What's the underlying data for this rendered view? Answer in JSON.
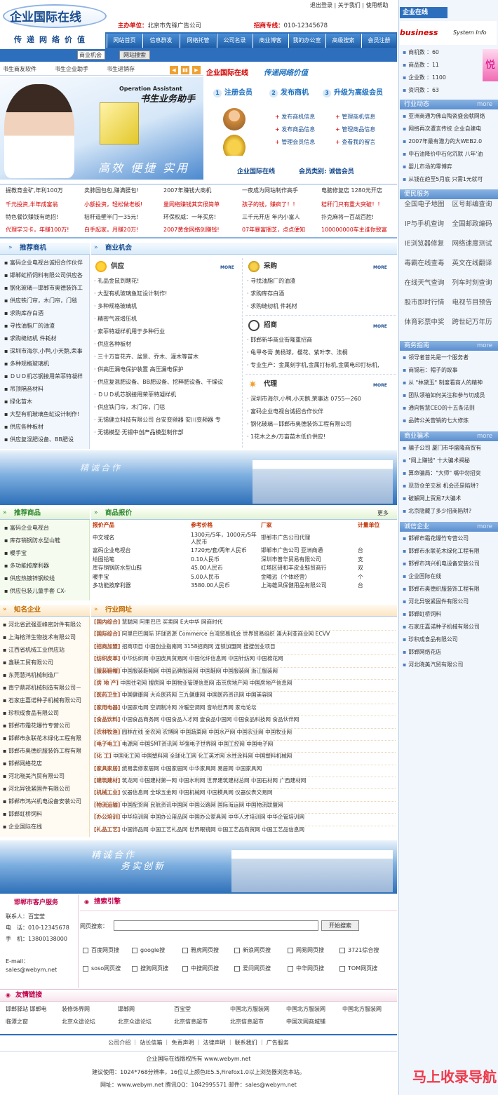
{
  "header": {
    "logo": "企业国际在线",
    "slogan": "传递网络价值",
    "sponsor_label": "主办单位：",
    "sponsor": "北京市先锋广告公司",
    "hotline_label": "招商专线：",
    "hotline": "010-12345678",
    "toplinks": [
      "退出登录",
      "关于我们",
      "使用帮助"
    ]
  },
  "nav": [
    "网站首页",
    "信息群发",
    "网络托管",
    "公司名录",
    "商业博客",
    "我的办公室",
    "高级搜索",
    "会员注册"
  ],
  "search": {
    "select": "商业机会",
    "button": "网站搜索"
  },
  "promo_tabs": [
    "书生商友软件",
    "书生企业助手",
    "书生进销存"
  ],
  "promo": {
    "product_tag": "Operation Assistant",
    "product_name": "书生业务助手",
    "tagline": "高效 便捷 实用",
    "site": "企业国际在线",
    "site_slogan": "传递网络价值",
    "steps": [
      {
        "n": "1",
        "label": "注册会员"
      },
      {
        "n": "2",
        "label": "发布商机"
      },
      {
        "n": "3",
        "label": "升级为高级会员"
      }
    ],
    "links_left": [
      "发布商机信息",
      "发布商品信息",
      "管理会员信息"
    ],
    "links_right": [
      "管理商机信息",
      "管理商品信息",
      "查看我的留言"
    ],
    "member_site": "企业国际在线",
    "member_type": "会员类别: 诚信会员"
  },
  "ads": [
    [
      "掘教育金矿,年利100万",
      "卖肺国包包,赚满腰包!",
      "2007年赚钱大商机",
      "一夜成为网站制作高手",
      "电脑修复店 1280元开店"
    ],
    [
      "千元投资,半年成富翁",
      "小额投资，轻松做老板!",
      "量网络赚钱其实很简单",
      "孩子的钱，赚疯了！！",
      "秸秆门只有重大突破！！"
    ],
    [
      "特色餐饮赚钱有绝招!",
      "秸秆造壁半门一35元!",
      "环保权威：一年买房!",
      "三千元开店 年内小富人",
      "扑克麻将一百战百胜!"
    ],
    [
      "代理学习卡，年赚100万!",
      "白手起家，月赚20万!",
      "2007黄金网络创赚钱!",
      "07年暴富捆芝，点点便知",
      "100000000车主谁你致富"
    ]
  ],
  "rec_business": {
    "title": "推荐商机",
    "items": [
      "富码企业电视台诚招合作伙伴",
      "邯郸虹桥饲料有限公司供应各",
      "钢化玻璃—邯郸市奥德装饰工",
      "供应铁门帘，木门帘，门毯",
      "求购库存白酒",
      "寻找油脂厂的油渣",
      "求购缝纫机 件耗材",
      "深圳市海尔,小鸭,小天鹅,荣事",
      "多种规格玻璃机",
      "ＤＵＤ机芯钢接用荣菲特凝样",
      "吊顶隔音材料",
      "绿化苗木",
      "大型有机玻璃鱼缸设计制作!",
      "供应各种板材",
      "供应复混肥设备、BB肥设"
    ]
  },
  "biz_opportunity": {
    "title": "商业机会",
    "more": "MORE",
    "supply": {
      "title": "供应",
      "items": [
        "礼品金鼠到瞎花!",
        "大型有机玻璃鱼缸设计制作!",
        "多种规格玻璃机",
        "精密气液增压机",
        "索菲特凝样机用于多种行业",
        "供应各种板材",
        "三十万盲花卉、盆景、乔木、灌木等苗木",
        "供高压漏电保护装置 高压漏电保护",
        "供应复混肥设备、BB肥设备、挖粹肥设备、干燥设",
        "ＤＵＤ机芯钢接用荣菲特凝样机",
        "供应铁门帘，木门帘，门毯",
        "无锡健立科技有限公司 台安变频器 安川变频器 专",
        "无锡模型·无锡中创产品模型制作部"
      ]
    },
    "buy": {
      "title": "采购",
      "items": [
        "寻找油脂厂的油渣",
        "求购库存白酒",
        "求购缝纫机 件耗材"
      ]
    },
    "invest": {
      "title": "招商",
      "items": [
        "邯郸新华商业街隆重招商",
        "龟甲冬膏 黄杨球，樱花、紫叶李、法桐",
        "专业生产：金属刻字机,金属打标机,金属电印打标机,"
      ]
    },
    "agent": {
      "title": "代理",
      "items": [
        "深圳市海尔,小鸭,小天鹅,荣事达 0755—260",
        "富码企业电视台诚招合作伙伴",
        "钢化玻璃—邯郸市奥德装饰工程有限公司",
        "1花木之乡/万亩苗木低价供应!"
      ]
    }
  },
  "banner1": "精诚合作",
  "rec_products": {
    "title": "推荐商品",
    "items": [
      "富码企业电视台",
      "库存销锅防水型山鞋",
      "暖手宝",
      "多功能按摩利器",
      "供应热镀锌钢绞线",
      "供应包装儿童手套 CX-"
    ]
  },
  "price": {
    "title": "商品报价",
    "more": "更多",
    "headers": [
      "报价产品",
      "参考价格",
      "厂家",
      "计量单位"
    ],
    "rows": [
      [
        "中文域名",
        "1300元/5年，1000元/5年人民币",
        "邯郸市广告公司代理",
        ""
      ],
      [
        "富码企业电视台",
        "1720元/套/两年人民币",
        "邯郸市广告公司 亚洲商通",
        "台"
      ],
      [
        "绘图铅笔",
        "0.10人民币",
        "深圳市普华贸易有限公司",
        "支"
      ],
      [
        "库存销锅防水型山鞋",
        "45.00人民币",
        "红塔区研和丰皮业鞋贸商行",
        "双"
      ],
      [
        "暖手宝",
        "5.00人民币",
        "金曦远（个体经营）",
        "个"
      ],
      [
        "多功能按摩利器",
        "3580.00人民币",
        "上海雄凤保健用品有限公司",
        "台"
      ]
    ]
  },
  "famous": {
    "title": "知名企业",
    "items": [
      "河北省武强亚峰密封件有限公",
      "上海榕洋生物技术有限公司",
      "江西省机械工业供应站",
      "鑫联工贸有限公司",
      "东莞慧鸿机械制造厂",
      "南宁鼎邦机械制造有限公司－",
      "石家庄嘉诺种子机械有限公司",
      "珍积成食品有限公司",
      "邯郸市霜花爆竹专营公司",
      "邯郸市永联花木绿化工程有限",
      "邯郸市奥德织服装饰工程有限",
      "邯郸网络花店",
      "河北晓美汽贸有限公司",
      "河北异锐紧固件有限公司",
      "邯郸市鸿兴机电设备安装公司",
      "邯郸虹桥饲料",
      "企业国际在线"
    ]
  },
  "industry": {
    "title": "行业网址",
    "rows": [
      [
        "[国内综合]",
        "慧聪网 阿里巴巴 买卖网 E大中华 网商时代"
      ],
      [
        "[国际综合]",
        "阿里巴巴国际 环球资源 Commerce 台湾贸易机会 世界贸易组织 澳大利亚商业网 ECVV"
      ],
      [
        "[招商加盟]",
        "招商项目 中国创业指南网 3158招商网 连锁加盟网 搜搜创业项目"
      ],
      [
        "[纺织皮革]",
        "中华纺织网 中国皮具贸易网 中国化纤信息网 中国针纺网 中国棉花网"
      ],
      [
        "[服装鞋帽]",
        "中国服装鞋帽网 中国品牌服装网 中国鞋网 中国服装网 浙江服装网"
      ],
      [
        "[房 地 产]",
        "中国住宅网 搜房网 中国物业管理信息网 南京房地产网 中国房地产信息网"
      ],
      [
        "[医药卫生]",
        "中国健康网 大众医药网 三九健康网 中国医药资讯网 中国美容网"
      ],
      [
        "[家用电器]",
        "中国家电网 空调制冷网 冷暖空调网 音响世界网 家电论坛"
      ],
      [
        "[食品饮料]",
        "中国食品商务网 中国食品人才网 壹食品中国网 中国食品科技网 食品伙伴网"
      ],
      [
        "[农林牧渔]",
        "园林在线 金农网 农博网 中国蔬菜网 中国水产网 中国农业网 中国牧业网"
      ],
      [
        "[电子电工]",
        "电源网 中国SMT资讯网 华强电子世界网 中国工控网 中国电子网"
      ],
      [
        "[化 工]",
        "中国化工网 中国塑料网 全球化工网 化工英才网 水性涂料网 中国塑料机械网"
      ],
      [
        "[家具家居]",
        "统易装修家居网 中国家居网 中华家具网 易居网 中国家具网"
      ],
      [
        "[建筑建材]",
        "筑龙网 中国建材第一网 中国水利网 世界建筑建材总网 中国石材网 广西建材网"
      ],
      [
        "[机械工业]",
        "仪器信息网 全球五金网 中国机械网 中国模具网 仪器仪表交易网"
      ],
      [
        "[物流运输]",
        "中国配货网 民航资讯中国网 中国公路网 国际海运网 中国物流联盟网"
      ],
      [
        "[办公培训]",
        "中华培训网 中国办公用品网 中国办公家具网 中华人才培训网 中华企管培训网"
      ],
      [
        "[礼品工艺]",
        "中国饰品网 中国工艺礼品网 世界眼镜网 中国工艺品商贸网 中国工艺品信息网"
      ]
    ]
  },
  "banner2": {
    "line1": "精诚合作",
    "line2": "务实创新"
  },
  "service": {
    "title": "邯郸市客户服务",
    "contact": "联系人：百宝莹",
    "phone": "电　话：010-12345678",
    "mobile": "手　机：13800138000",
    "email_label": "E-mail：",
    "email": "sales@webym.net"
  },
  "search_engine": {
    "title": "搜索引擎",
    "label": "网页搜索：",
    "button": "开始搜索",
    "row1": [
      "百度网页搜",
      "google搜",
      "雅虎网页搜",
      "新浪网页搜",
      "网易网页搜",
      "3721综合搜"
    ],
    "row2": [
      "soso网页搜",
      "搜狗网页搜",
      "中搜网页搜",
      "爱问网页搜",
      "中华网页搜",
      "TOM网页搜"
    ]
  },
  "links": {
    "title": "友情链接",
    "rows": [
      [
        "邯郸驿站 邯郸电",
        "装修饰界网",
        "邯郸网",
        "百宝堂",
        "中国北方服装网",
        "中国北方服装网",
        "中国北方服装网"
      ],
      [
        "临潭之窗",
        "北京众途论坛",
        "北京众途论坛",
        "北京信息超市",
        "北京信息超市",
        "中国次网商城铺",
        ""
      ]
    ]
  },
  "footer": {
    "links": [
      "公司介绍",
      "站长信箱",
      "免责声明",
      "法律声明",
      "联系我们",
      "广告服务"
    ],
    "copyright": "企业国际在线版权所有 www.webym.net",
    "advice": "建议使用：1024*768分辨率，16位以上颜色IE5.5,Firefox1.0以上浏览器浏览本站。",
    "contact": "网址：www.webym.net 腾讯QQ：1042995571 邮件：sales@webym.net",
    "watermark": "马上收录导航"
  },
  "side": {
    "brand": "企业在线",
    "business": "business",
    "system": "System Info",
    "stats": [
      "商机数 ：60",
      "商品数 ：11",
      "企业数 ：1100",
      "资讯数 ：63"
    ],
    "industry": {
      "title": "行业动态",
      "more": "more",
      "items": [
        "亚洲商通为佛山陶瓷盛会献网络",
        "网络再次遭言传统 企业自建电",
        "2007年最有潜力的大WEB2.0",
        "中石油降价中石化沉默 八年'油",
        "婴儿市场的零博弈",
        "从钱在趋至5月底 只需1元就可"
      ]
    },
    "convenience": {
      "title": "便民服务",
      "items": [
        [
          "全国电子地图",
          "区号邮编查询"
        ],
        [
          "IP与手机查询",
          "全国邮政编码"
        ],
        [
          "IE浏览器修复",
          "网络速度测试"
        ],
        [
          "毒霸在线查毒",
          "英文在线翻译"
        ],
        [
          "在线天气查询",
          "列车时刻查询"
        ],
        [
          "股市即时行情",
          "电视节目预告"
        ],
        [
          "体育彩票中奖",
          "跨世纪万年历"
        ]
      ]
    },
    "guide": {
      "title": "商务指南",
      "more": "more",
      "items": [
        "领导者首先是一个服务者",
        "商锡岩：帽子的故事",
        "从 \"林黛玉\" 制度看商人的精神",
        "团队领袖如何关注和参与切成员",
        "通向智慧CEO的十五条法则",
        "品牌公关营销的七大修炼"
      ]
    },
    "scam": {
      "title": "商业骗术",
      "more": "more",
      "items": [
        "骗子公司 厦门市华盛隆商贸有",
        "\"网上赚钱\" 十大骗术揭秘",
        "算命骗局：\"大师\" 嘴中勿招突",
        "现货仓单交易 机会还是陷阱?",
        "破解网上贸易7大骗术",
        "北京隐藏了多少招商陷阱?"
      ]
    },
    "trust": {
      "title": "诚信企业",
      "more": "more",
      "items": [
        "邯郸市霜花爆竹专营公司",
        "邯郸市永联花木绿化工程有限",
        "邯郸市鸿兴机电设备安装公司",
        "企业国际在线",
        "邯郸市奥德织服装饰工程有限",
        "河北异锐紧固件有限公司",
        "邯郸虹桥饲料",
        "石家庄嘉诺种子机械有限公司",
        "珍积成食品有限公司",
        "邯郸网络花店",
        "河北晓美汽贸有限公司"
      ]
    }
  },
  "colors": {
    "brand": "#1a4d8f",
    "accent": "#d40000",
    "nav": "#2e6fbd"
  }
}
